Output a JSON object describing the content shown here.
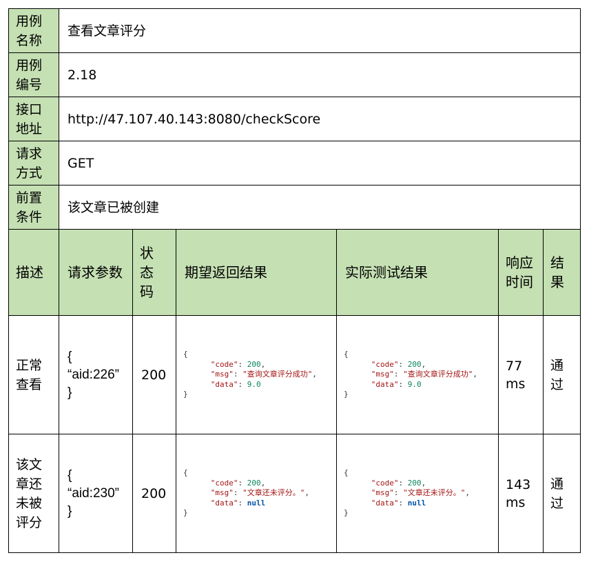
{
  "meta": {
    "case_name_label": "用例\n名称",
    "case_name": "查看文章评分",
    "case_no_label": "用例\n编号",
    "case_no": "2.18",
    "api_label": "接口\n地址",
    "api": "http://47.107.40.143:8080/checkScore",
    "method_label": "请求\n方式",
    "method": "GET",
    "precondition_label": "前置\n条件",
    "precondition": "该文章已被创建"
  },
  "headers": {
    "desc": "描述",
    "params": "请求参数",
    "status": "状\n态\n码",
    "expected": "期望返回结果",
    "actual": "实际测试结果",
    "time": "响应\n时间",
    "result": "结\n果"
  },
  "rows": [
    {
      "desc": "正常\n查看",
      "param_open": "{",
      "param": "“aid:226”",
      "param_close": "}",
      "status": "200",
      "json": {
        "open": "{",
        "code_key": "\"code\"",
        "code_val": "200",
        "msg_key": "\"msg\"",
        "msg_val": "\"查询文章评分成功\"",
        "data_key": "\"data\"",
        "data_val": "9.0",
        "close": "}"
      },
      "time": "77\nms",
      "result": "通\n过"
    },
    {
      "desc": "该文\n章还\n未被\n评分",
      "param_open": "{",
      "param": "“aid:230”",
      "param_close": "}",
      "status": "200",
      "json": {
        "open": "{",
        "code_key": "\"code\"",
        "code_val": "200",
        "msg_key": "\"msg\"",
        "msg_val": "\"文章还未评分。\"",
        "data_key": "\"data\"",
        "data_val": "null",
        "close": "}"
      },
      "time": "143\nms",
      "result": "通\n过"
    }
  ]
}
